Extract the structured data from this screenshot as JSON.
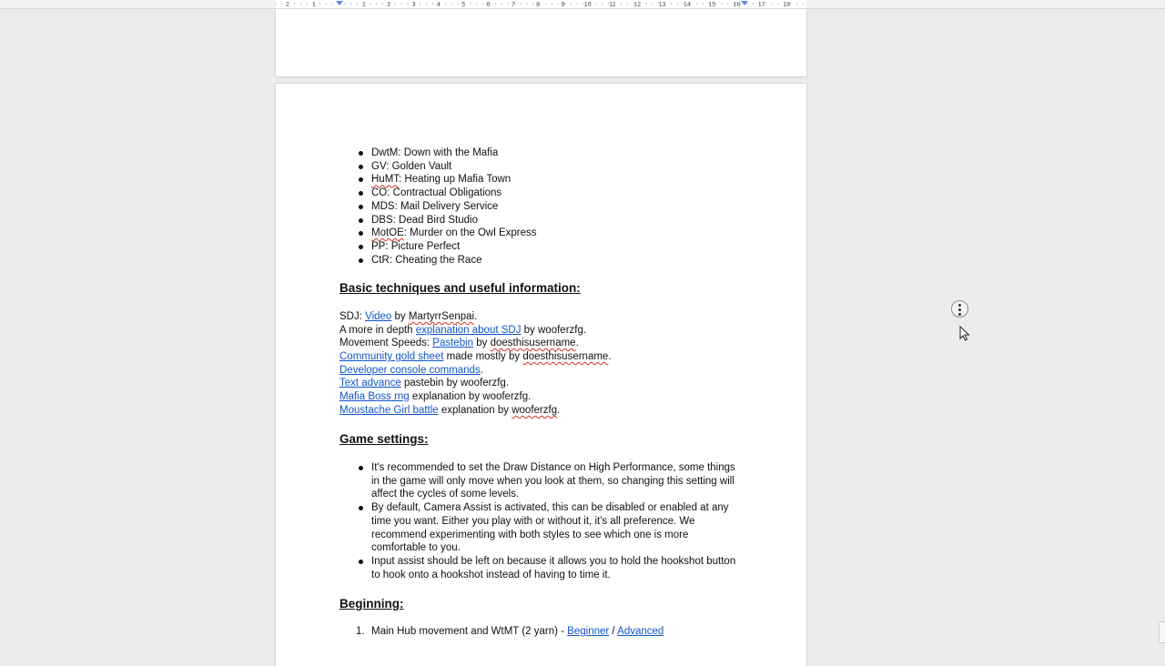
{
  "ruler": {
    "numbers": [
      "2",
      "1",
      "1",
      "2",
      "3",
      "4",
      "5",
      "6",
      "7",
      "8",
      "9",
      "10",
      "11",
      "12",
      "13",
      "14",
      "15",
      "16",
      "17",
      "18"
    ]
  },
  "top_list": [
    {
      "abbr": "DwtM",
      "rest": ": Down with the Mafia",
      "sq": false
    },
    {
      "abbr": "GV",
      "rest": ": Golden Vault",
      "sq": false
    },
    {
      "abbr": "HuMT",
      "rest": ": Heating up Mafia Town",
      "sq": true
    },
    {
      "abbr": "CO",
      "rest": ": Contractual Obligations",
      "sq": false
    },
    {
      "abbr": "MDS",
      "rest": ": Mail Delivery Service",
      "sq": false
    },
    {
      "abbr": "DBS",
      "rest": ": Dead Bird Studio",
      "sq": false
    },
    {
      "abbr": "MotOE",
      "rest": ": Murder on the Owl Express",
      "sq": true
    },
    {
      "abbr": "PP",
      "rest": ": Picture Perfect",
      "sq": false
    },
    {
      "abbr": "CtR",
      "rest": ": Cheating the Race",
      "sq": false
    }
  ],
  "basic": {
    "heading": "Basic techniques and useful information:",
    "sdj_prefix": "SDJ: ",
    "sdj_link": "Video",
    "sdj_by": " by ",
    "sdj_author": "MartyrrSenpai",
    "period": ".",
    "depth_prefix": "A more in depth ",
    "depth_link": "explanation about SDJ",
    "depth_suffix": " by wooferzfg.",
    "speeds_prefix": "Movement Speeds: ",
    "speeds_link": "Pastebin",
    "speeds_by": " by ",
    "speeds_author": "doesthisusername",
    "gold_link": "Community gold sheet",
    "gold_mid": " made mostly by ",
    "gold_author": "doesthisusername",
    "console_link": "Developer console commands",
    "text_link": "Text advance",
    "text_suffix": " pastebin by wooferzfg.",
    "boss_link": "Mafia Boss rng",
    "boss_suffix": " explanation by wooferzfg.",
    "moustache_link": "Moustache Girl battle",
    "moustache_mid": " explanation by ",
    "moustache_author": "wooferzfg"
  },
  "settings": {
    "heading": "Game settings:",
    "items": [
      "It's recommended to set the Draw Distance on High Performance, some things in the game will only move when you look at them, so changing this setting will affect the cycles of some levels.",
      "By default, Camera Assist is activated, this can be disabled or enabled at any time you want. Either you play with or without it, it's all preference. We recommend experimenting with both styles to see which one is more comfortable to you.",
      "Input assist should be left on because it allows you to hold the hookshot button to hook onto a hookshot instead of having to time it."
    ]
  },
  "beginning": {
    "heading": "Beginning:",
    "item_number": "1.",
    "item_text": "Main Hub movement and WtMT (2 yarn) - ",
    "link1": "Beginner",
    "sep": " / ",
    "link2": "Advanced"
  },
  "icons": {
    "scroll": "scroll-options-icon",
    "cursor": "mouse-pointer-icon"
  },
  "colors": {
    "link": "#1155cc",
    "spellcheck": "#d93025",
    "background": "#ececec"
  }
}
